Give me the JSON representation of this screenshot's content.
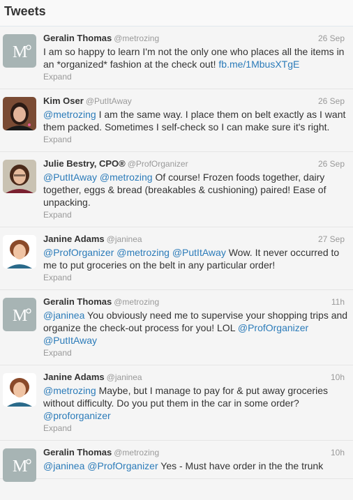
{
  "header": {
    "title": "Tweets"
  },
  "expand_label": "Expand",
  "tweets": [
    {
      "name": "Geralin Thomas",
      "handle": "@metrozing",
      "time": "26 Sep",
      "avatar": "metrozing-logo",
      "text_before": "I am so happy to learn I'm not the only one who places all the items in an *organized* fashion at the check out! ",
      "link": "fb.me/1MbusXTgE"
    },
    {
      "name": "Kim Oser",
      "handle": "@PutItAway",
      "time": "26 Sep",
      "avatar": "woman-photo",
      "mention1": "@metrozing",
      "text_after": " I am the same way. I place them on belt exactly as I want them packed. Sometimes I self-check so I can make sure it's right."
    },
    {
      "name": "Julie Bestry, CPO®",
      "handle": "@ProfOrganizer",
      "time": "26 Sep",
      "avatar": "woman-photo",
      "mention1": "@PutItAway",
      "mention2": "@metrozing",
      "text_after": " Of course! Frozen foods together, dairy together, eggs & bread (breakables & cushioning) paired! Ease of unpacking."
    },
    {
      "name": "Janine Adams",
      "handle": "@janinea",
      "time": "27 Sep",
      "avatar": "woman-photo",
      "mention1": "@ProfOrganizer",
      "mention2": "@metrozing",
      "mention3": "@PutItAway",
      "text_after": " Wow. It never occurred to me to put groceries on the belt in any particular order!"
    },
    {
      "name": "Geralin Thomas",
      "handle": "@metrozing",
      "time": "11h",
      "avatar": "metrozing-logo",
      "mention1": "@janinea",
      "text_after": " You obviously need me to supervise your shopping trips and organize the check-out process for you! LOL ",
      "mention2": "@ProfOrganizer",
      "mention3": "@PutItAway"
    },
    {
      "name": "Janine Adams",
      "handle": "@janinea",
      "time": "10h",
      "avatar": "woman-photo",
      "mention1": "@metrozing",
      "text_after": " Maybe, but I manage to pay for & put away groceries without difficulty. Do you put them in the car in some order? ",
      "mention2": "@proforganizer"
    },
    {
      "name": "Geralin Thomas",
      "handle": "@metrozing",
      "time": "10h",
      "avatar": "metrozing-logo",
      "mention1": "@janinea",
      "mention2": "@ProfOrganizer",
      "text_after": " Yes - Must have order in the the trunk"
    }
  ]
}
